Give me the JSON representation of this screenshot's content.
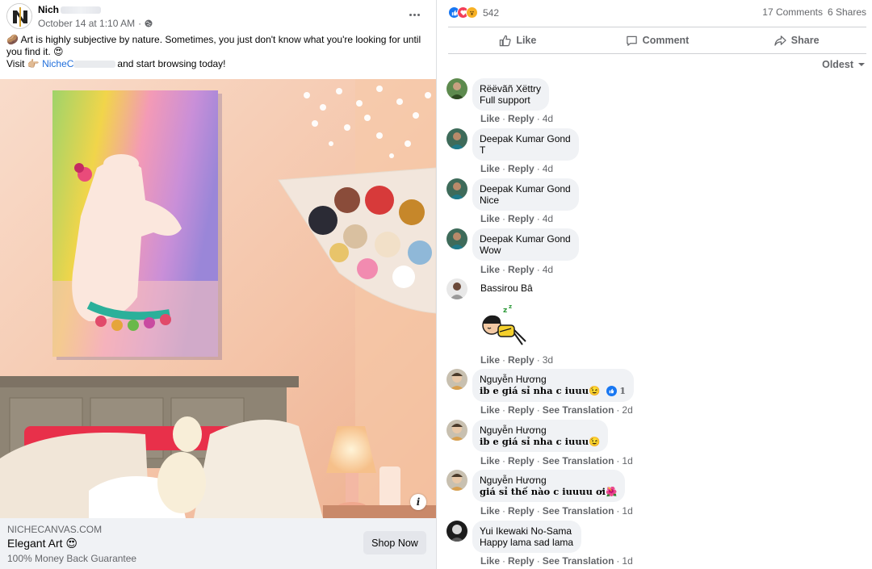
{
  "post": {
    "page_name": "Nich",
    "timestamp": "October 14 at 1:10 AM",
    "separator": "·",
    "text_line1": "🥔 Art is highly subjective by nature. Sometimes, you just don't know what you're looking for until",
    "text_line2": "you find it. 😍",
    "text_line3_prefix": "Visit 👉🏼 ",
    "text_link": "NicheC",
    "text_line3_suffix": "and start browsing today!",
    "info_label": "i",
    "cta": {
      "domain": "NICHECANVAS.COM",
      "title": "Elegant Art 😍",
      "subtitle": "100% Money Back Guarantee",
      "button": "Shop Now"
    }
  },
  "engagement": {
    "reaction_count": "542",
    "comments_count": "17 Comments",
    "shares_count": "6 Shares",
    "actions": {
      "like": "Like",
      "comment": "Comment",
      "share": "Share"
    },
    "sort_label": "Oldest"
  },
  "comments": [
    {
      "name": "Rëëvãñ Xëttry",
      "text": "Full support",
      "like": "Like",
      "reply": "Reply",
      "time": "4d"
    },
    {
      "name": "Deepak Kumar Gond",
      "text": "T",
      "like": "Like",
      "reply": "Reply",
      "time": "4d"
    },
    {
      "name": "Deepak Kumar Gond",
      "text": "Nice",
      "like": "Like",
      "reply": "Reply",
      "time": "4d"
    },
    {
      "name": "Deepak Kumar Gond",
      "text": "Wow",
      "like": "Like",
      "reply": "Reply",
      "time": "4d"
    },
    {
      "name": "Bassirou Bâ",
      "text": "",
      "like": "Like",
      "reply": "Reply",
      "time": "3d"
    },
    {
      "name": "Nguyễn Hương",
      "text": "ib e giá sỉ nha c iuuu😉",
      "like": "Like",
      "reply": "Reply",
      "translate": "See Translation",
      "time": "2d",
      "reactions": "1"
    },
    {
      "name": "Nguyễn Hương",
      "text": "ib e giá sỉ nha c iuuu😉",
      "like": "Like",
      "reply": "Reply",
      "translate": "See Translation",
      "time": "1d"
    },
    {
      "name": "Nguyễn Hương",
      "text": "giá sỉ thế nào c iuuuu ơi🌺",
      "like": "Like",
      "reply": "Reply",
      "translate": "See Translation",
      "time": "1d"
    },
    {
      "name": "Yui Ikewaki No-Sama",
      "text": "Happy lama sad lama",
      "like": "Like",
      "reply": "Reply",
      "translate": "See Translation",
      "time": "1d"
    }
  ],
  "colors": {
    "link": "#216fdb",
    "muted": "#65676b",
    "bubble": "#f0f2f5",
    "like_blue": "#1877f2"
  }
}
